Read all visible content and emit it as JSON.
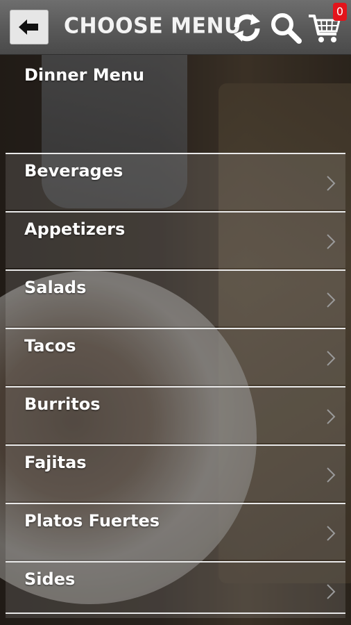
{
  "header": {
    "title": "CHOOSE MENU",
    "cart_count": "0",
    "icons": [
      "back-arrow-icon",
      "refresh-icon",
      "search-icon",
      "cart-icon"
    ]
  },
  "menu": {
    "section_title": "Dinner Menu",
    "items": [
      {
        "label": "Beverages"
      },
      {
        "label": "Appetizers"
      },
      {
        "label": "Salads"
      },
      {
        "label": "Tacos"
      },
      {
        "label": "Burritos"
      },
      {
        "label": "Fajitas"
      },
      {
        "label": "Platos Fuertes"
      },
      {
        "label": "Sides"
      }
    ]
  },
  "colors": {
    "topbar": "#5a5a5a",
    "badge": "#e3141b",
    "divider": "#e9e9e9",
    "text": "#ffffff"
  }
}
